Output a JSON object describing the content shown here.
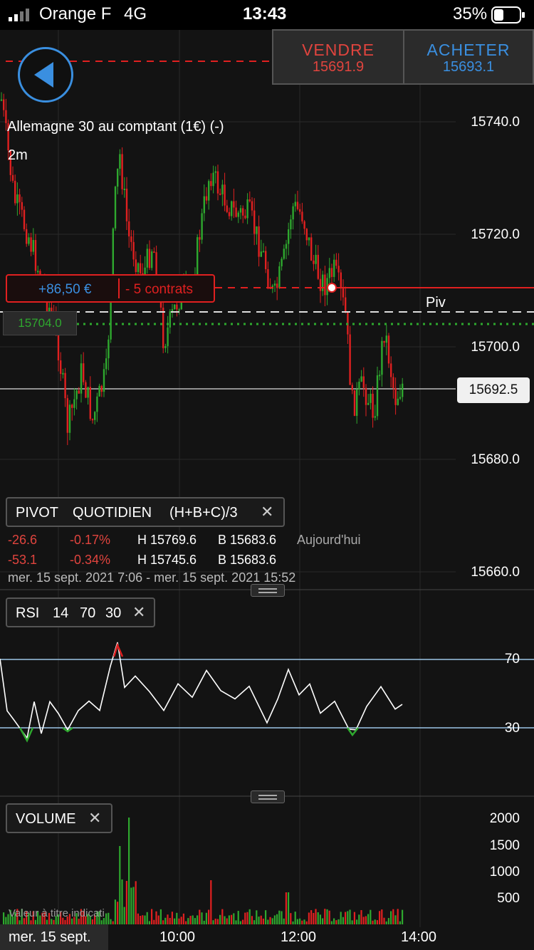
{
  "status_bar": {
    "carrier": "Orange F",
    "network": "4G",
    "time": "13:43",
    "battery": "35%"
  },
  "trade": {
    "sell_label": "VENDRE",
    "sell_price": "15691.9",
    "buy_label": "ACHETER",
    "buy_price": "15693.1"
  },
  "chart": {
    "instrument": "Allemagne 30 au comptant (1€) (-)",
    "timeframe": "2m",
    "price_ticks": [
      "15740.0",
      "15720.0",
      "15700.0",
      "15692.5",
      "15680.0",
      "15660.0"
    ],
    "position": {
      "pnl": "+86,50 €",
      "size": "- 5 contrats"
    },
    "pivot_value": "15704.0",
    "pivot_label": "Piv"
  },
  "pivot_panel": {
    "name": "PIVOT",
    "period": "QUOTIDIEN",
    "formula": "(H+B+C)/3",
    "row1": {
      "chg": "-26.6",
      "pct": "-0.17%",
      "high": "H 15769.6",
      "low": "B 15683.6",
      "label": "Aujourd'hui"
    },
    "row2": {
      "chg": "-53.1",
      "pct": "-0.34%",
      "high": "H 15745.6",
      "low": "B 15683.6"
    },
    "range": "mer. 15 sept. 2021 7:06 - mer. 15 sept. 2021 15:52"
  },
  "rsi": {
    "name": "RSI",
    "period": "14",
    "upper": "70",
    "lower": "30",
    "tick_70": "70",
    "tick_30": "30"
  },
  "volume": {
    "name": "VOLUME",
    "ticks": [
      "2000",
      "1500",
      "1000",
      "500"
    ],
    "disclaimer": "Valeur à titre indicati"
  },
  "xaxis": {
    "date": "mer. 15 sept.",
    "ticks": [
      "10:00",
      "12:00",
      "14:00"
    ]
  },
  "colors": {
    "up": "#2ea82e",
    "down": "#e02020",
    "sell": "#e0443e",
    "buy": "#3a8fe0"
  }
}
